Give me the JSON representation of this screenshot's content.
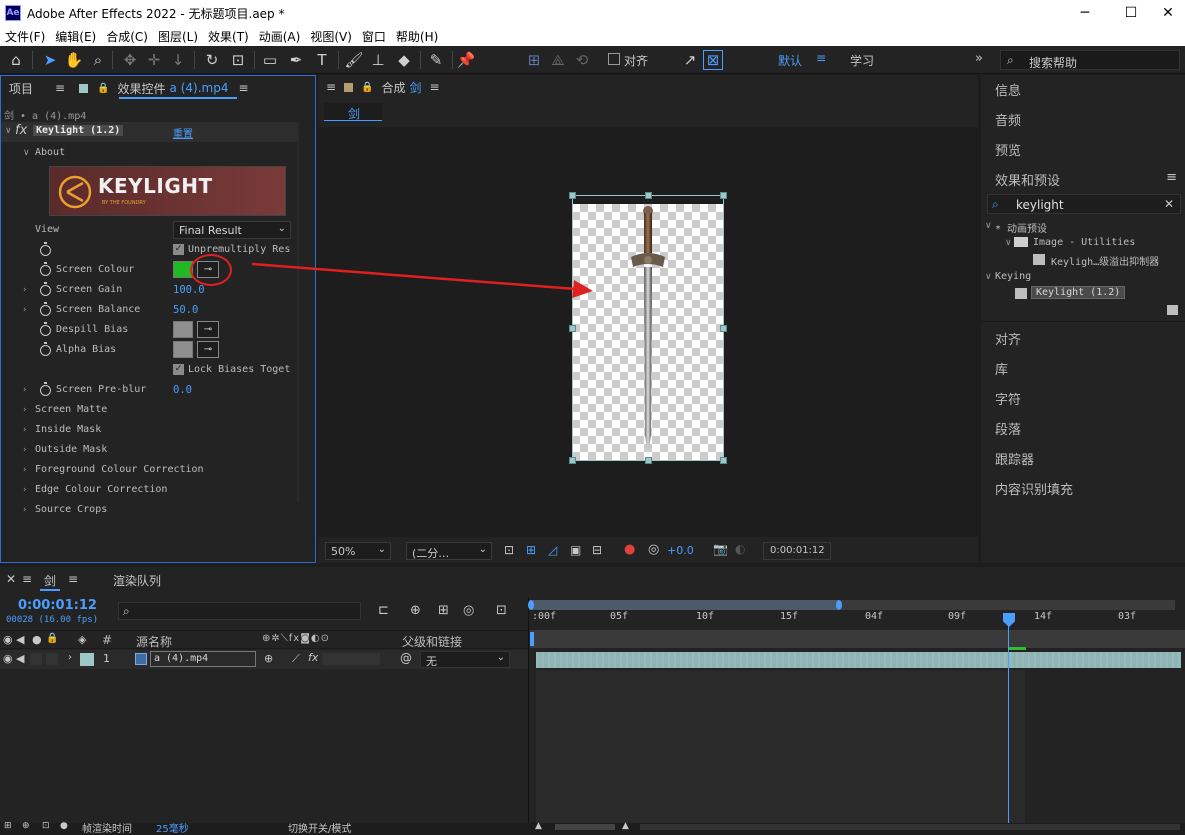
{
  "window": {
    "title": "Adobe After Effects 2022 - 无标题项目.aep *",
    "logo": "Ae"
  },
  "menu": [
    "文件(F)",
    "编辑(E)",
    "合成(C)",
    "图层(L)",
    "效果(T)",
    "动画(A)",
    "视图(V)",
    "窗口",
    "帮助(H)"
  ],
  "toolbar": {
    "align_label": "对齐",
    "workspace_default": "默认",
    "workspace_learn": "学习",
    "search_help": "搜索帮助"
  },
  "left_panel": {
    "tab_project": "项目",
    "tab_effects": "效果控件",
    "tab_effects_file": "a (4).mp4",
    "breadcrumb": "剑 • a (4).mp4",
    "effect_name": "Keylight (1.2)",
    "reset": "重置",
    "about": "About",
    "logo_text": "KEYLIGHT",
    "logo_sub": "BY THE FOUNDRY",
    "view_label": "View",
    "view_value": "Final Result",
    "unpremultiply": "Unpremultiply Res",
    "screen_colour": "Screen Colour",
    "screen_colour_value": "#22b822",
    "screen_gain": "Screen Gain",
    "screen_gain_value": "100.0",
    "screen_balance": "Screen Balance",
    "screen_balance_value": "50.0",
    "despill_bias": "Despill Bias",
    "alpha_bias": "Alpha Bias",
    "lock_biases": "Lock Biases Toget",
    "screen_preblur": "Screen Pre-blur",
    "screen_preblur_value": "0.0",
    "groups": [
      "Screen Matte",
      "Inside Mask",
      "Outside Mask",
      "Foreground Colour Correction",
      "Edge Colour Correction",
      "Source Crops"
    ]
  },
  "comp_panel": {
    "tab": "合成",
    "comp_name": "剑",
    "subtab": "剑",
    "zoom": "50%",
    "resolution": "(二分…",
    "exposure": "+0.0",
    "timecode": "0:00:01:12"
  },
  "right_panel": {
    "items_top": [
      "信息",
      "音频",
      "预览",
      "效果和预设"
    ],
    "search_value": "keylight",
    "tree": {
      "animation_presets": "* 动画预设",
      "image_utilities": "Image - Utilities",
      "keylight_suppressor": "Keyligh…级溢出抑制器",
      "keying": "Keying",
      "keylight_item": "Keylight (1.2)"
    },
    "items_bottom": [
      "对齐",
      "库",
      "字符",
      "段落",
      "跟踪器",
      "内容识别填充"
    ]
  },
  "timeline": {
    "tab_comp": "剑",
    "tab_render": "渲染队列",
    "timecode": "0:00:01:12",
    "frame_info": "00028 (16.00 fps)",
    "col_source": "源名称",
    "col_parent": "父级和链接",
    "layer_number": "1",
    "layer_name": "a (4).mp4",
    "parent_value": "无",
    "ruler": [
      ":00f",
      "05f",
      "10f",
      "15f",
      "04f",
      "09f",
      "14f",
      "03f"
    ],
    "footer_render_label": "帧渲染时间",
    "footer_render_value": "25毫秒",
    "footer_toggle": "切换开关/模式"
  },
  "colors": {
    "accent": "#4a9eff",
    "panel": "#232323",
    "bg": "#1d1d1d",
    "highlight": "#e02020"
  }
}
